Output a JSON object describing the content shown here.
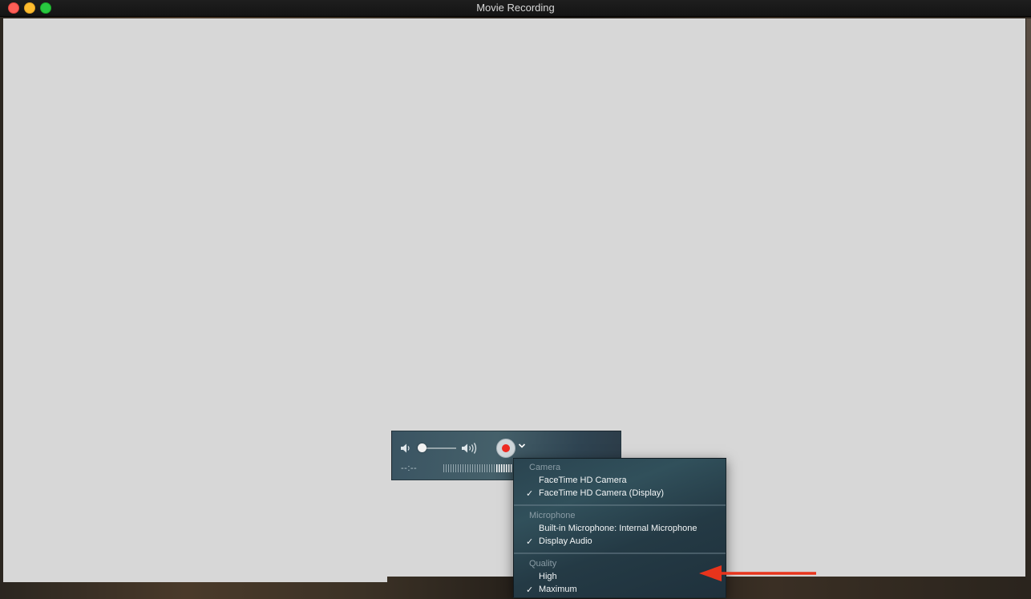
{
  "window": {
    "title": "Movie Recording"
  },
  "controls": {
    "timecode": "--:--",
    "record_color": "#ee2b22",
    "volume_level": 0.1,
    "icons": [
      "speaker-low-icon",
      "speaker-high-icon",
      "record-icon",
      "chevron-down-icon"
    ]
  },
  "menu": {
    "camera_header": "Camera",
    "camera_items": [
      {
        "label": "FaceTime HD Camera",
        "checked": false
      },
      {
        "label": "FaceTime HD Camera (Display)",
        "checked": true
      }
    ],
    "microphone_header": "Microphone",
    "microphone_items": [
      {
        "label": "Built-in Microphone: Internal Microphone",
        "checked": false
      },
      {
        "label": "Display Audio",
        "checked": true
      }
    ],
    "quality_header": "Quality",
    "quality_items": [
      {
        "label": "High",
        "checked": false
      },
      {
        "label": "Maximum",
        "checked": true
      }
    ],
    "check_mark": "✓"
  },
  "annotation": {
    "arrow_color": "#e8341c"
  }
}
